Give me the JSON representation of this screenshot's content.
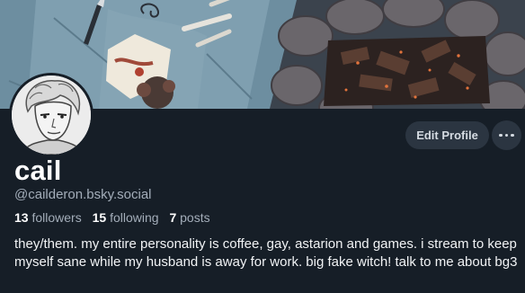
{
  "colors": {
    "background": "#161e27",
    "button_bg": "#2b3541",
    "muted_text": "#a3adb9",
    "primary_text": "#f1f3f5"
  },
  "profile": {
    "display_name": "cail",
    "handle": "@cailderon.bsky.social",
    "bio": "they/them. my entire personality is coffee, gay, astarion and games. i stream to keep myself sane while my husband is away for work. big fake witch! talk to me about bg3"
  },
  "stats": {
    "followers_count": "13",
    "followers_label": "followers",
    "following_count": "15",
    "following_label": "following",
    "posts_count": "7",
    "posts_label": "posts"
  },
  "actions": {
    "edit_profile_label": "Edit Profile",
    "more_icon": "more-horizontal-icon"
  }
}
